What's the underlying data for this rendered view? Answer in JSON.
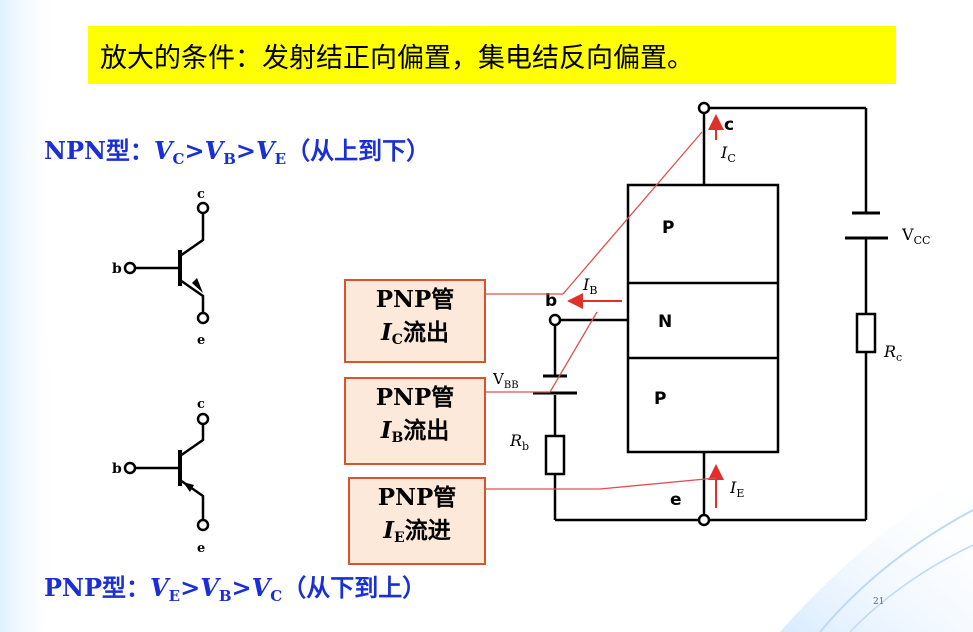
{
  "title": "放大的条件：发射结正向偏置，集电结反向偏置。",
  "npn_rule": {
    "label": "NPN型：",
    "v1": "V",
    "s1": "C",
    "g1": ">",
    "v2": "V",
    "s2": "B",
    "g2": ">",
    "v3": "V",
    "s3": "E",
    "note": "（从上到下）"
  },
  "pnp_rule": {
    "label": "PNP型：",
    "v1": "V",
    "s1": "E",
    "g1": ">",
    "v2": "V",
    "s2": "B",
    "g2": ">",
    "v3": "V",
    "s3": "C",
    "note": "（从下到上）"
  },
  "symbols": {
    "npn": {
      "c": "c",
      "b": "b",
      "e": "e"
    },
    "pnp": {
      "c": "c",
      "b": "b",
      "e": "e"
    }
  },
  "callouts": [
    {
      "line1": "PNP管",
      "var": "I",
      "sub": "C",
      "rest": "流出"
    },
    {
      "line1": "PNP管",
      "var": "I",
      "sub": "B",
      "rest": "流出"
    },
    {
      "line1": "PNP管",
      "var": "I",
      "sub": "E",
      "rest": "流进"
    }
  ],
  "circuit": {
    "layers": [
      "P",
      "N",
      "P"
    ],
    "terminal_c": "c",
    "terminal_b": "b",
    "terminal_e": "e",
    "ic": {
      "v": "I",
      "s": "C"
    },
    "ib": {
      "v": "I",
      "s": "B"
    },
    "ie": {
      "v": "I",
      "s": "E"
    },
    "vbb": {
      "v": "V",
      "s": "BB"
    },
    "vcc": {
      "v": "V",
      "s": "CC"
    },
    "rb": {
      "v": "R",
      "s": "b"
    },
    "rc": {
      "v": "R",
      "s": "c"
    }
  },
  "page_number": "21",
  "colors": {
    "title_bg": "#ffff00",
    "rule_text": "#1a2fd6",
    "callout_bg": "#fde9d9",
    "callout_border": "#d9542b",
    "arrow": "#e0302a",
    "leader": "#e05050"
  }
}
